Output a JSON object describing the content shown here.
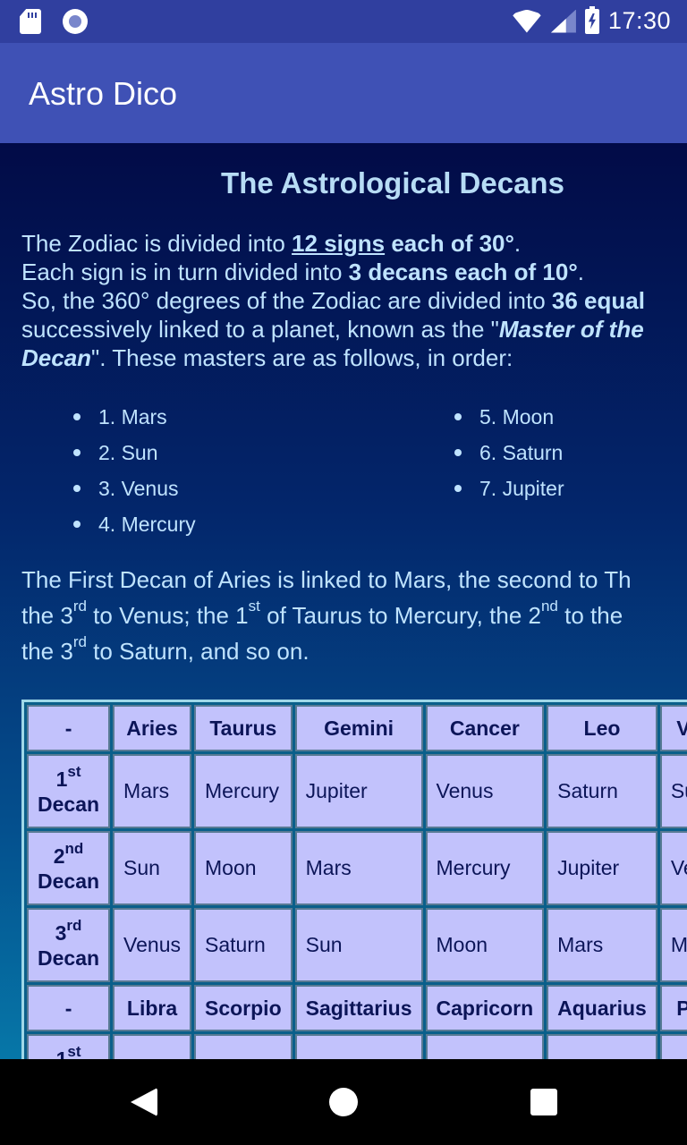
{
  "status_bar": {
    "time": "17:30",
    "icons": [
      "sd-card-icon",
      "recording-icon",
      "wifi-icon",
      "cell-signal-icon",
      "battery-charging-icon"
    ]
  },
  "app_bar": {
    "title": "Astro Dico"
  },
  "page": {
    "title": "The Astrological Decans",
    "intro": {
      "l1_a": "The Zodiac is divided into ",
      "l1_link": "12 signs",
      "l1_b": " each of 30°",
      "l1_c": ".",
      "l2_a": "Each sign is in turn divided into ",
      "l2_b": "3 decans each of 10°",
      "l2_c": ".",
      "l3_a": "So, the 360° degrees of the Zodiac are divided into ",
      "l3_b": "36 equal",
      "l4_a": "successively linked to a planet, known as the \"",
      "l4_b": "Master of the",
      "l5_a": "Decan",
      "l5_b": "\". These masters are as follows, in order:"
    },
    "planets_col1": [
      "1. Mars",
      "2. Sun",
      "3. Venus",
      "4. Mercury"
    ],
    "planets_col2": [
      "5. Moon",
      "6. Saturn",
      "7. Jupiter"
    ],
    "explain": {
      "l1": "The First Decan of Aries is linked to Mars, the second to Th",
      "l2_a": "the 3",
      "l2_sup1": "rd",
      "l2_b": " to Venus; the 1",
      "l2_sup2": "st",
      "l2_c": " of Taurus to Mercury, the 2",
      "l2_sup3": "nd",
      "l2_d": " to the",
      "l3_a": "the 3",
      "l3_sup": "rd",
      "l3_b": " to Saturn, and so on."
    }
  },
  "table": {
    "decan_word": "Decan",
    "ordinals": [
      {
        "num": "1",
        "sup": "st"
      },
      {
        "num": "2",
        "sup": "nd"
      },
      {
        "num": "3",
        "sup": "rd"
      },
      {
        "num": "1",
        "sup": "st"
      }
    ],
    "header1": [
      "-",
      "Aries",
      "Taurus",
      "Gemini",
      "Cancer",
      "Leo",
      "V"
    ],
    "rows1": [
      [
        "Mars",
        "Mercury",
        "Jupiter",
        "Venus",
        "Saturn",
        "Su"
      ],
      [
        "Sun",
        "Moon",
        "Mars",
        "Mercury",
        "Jupiter",
        "Ve"
      ],
      [
        "Venus",
        "Saturn",
        "Sun",
        "Moon",
        "Mars",
        "M"
      ]
    ],
    "header2": [
      "-",
      "Libra",
      "Scorpio",
      "Sagittarius",
      "Capricorn",
      "Aquarius",
      "P"
    ]
  },
  "nav_bar": {
    "back": "back-icon",
    "home": "home-icon",
    "recents": "recents-icon"
  }
}
